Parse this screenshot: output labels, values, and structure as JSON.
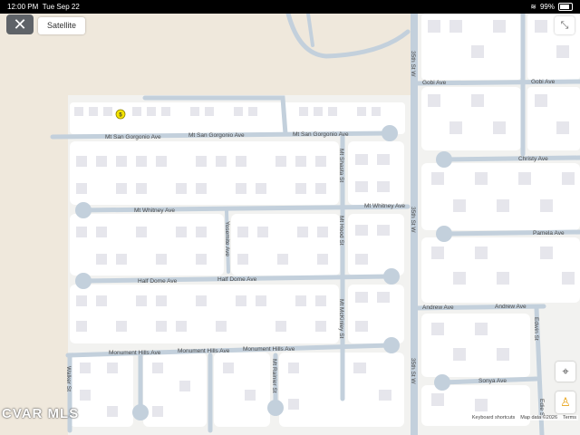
{
  "status_bar": {
    "time": "12:00 PM",
    "date": "Tue Sep 22",
    "battery": "99%"
  },
  "controls": {
    "close_icon": "close-icon",
    "map_type_label": "Satellite",
    "fullscreen_icon": "fullscreen-exit-icon",
    "location_icon": "crosshair-icon",
    "pegman_icon": "pegman-icon"
  },
  "marker": {
    "label": "5",
    "color": "#f5e400"
  },
  "watermark": "CVAR MLS",
  "attribution": {
    "shortcuts": "Keyboard shortcuts",
    "data": "Map data ©2026",
    "terms": "Terms"
  },
  "streets": {
    "mt_san_gorgonio_1": "Mt San Gorgonio Ave",
    "mt_san_gorgonio_2": "Mt San Gorgonio Ave",
    "mt_san_gorgonio_3": "Mt San Gorgonio Ave",
    "mt_whitney_1": "Mt Whitney Ave",
    "mt_whitney_2": "Mt Whitney Ave",
    "half_dome_1": "Half Dome Ave",
    "half_dome_2": "Half Dome Ave",
    "monument_hills_1": "Monument Hills Ave",
    "monument_hills_2": "Monument Hills Ave",
    "monument_hills_3": "Monument Hills Ave",
    "mt_shasta": "Mt Shasta St",
    "mt_hood": "Mt Hood St",
    "mt_mckinley": "Mt McKinley St",
    "yosemite": "Yosemite Ave",
    "mt_rainier": "Mt Rainier St",
    "walker": "Walker St",
    "st35_1": "35th St W",
    "st35_2": "35th St W",
    "st35_3": "35th St W",
    "gobi": "Gobi Ave",
    "christy": "Christy Ave",
    "pamela": "Pamela Ave",
    "andrew_1": "Andrew Ave",
    "andrew_2": "Andrew Ave",
    "sonya": "Sonya Ave",
    "edwin": "Edwin St",
    "edie": "Edie St"
  },
  "colors": {
    "road": "#c3d0dc",
    "block": "#ffffff",
    "building": "#e6e6ec",
    "land": "#f2f2f0",
    "sand": "#efe8dc"
  }
}
